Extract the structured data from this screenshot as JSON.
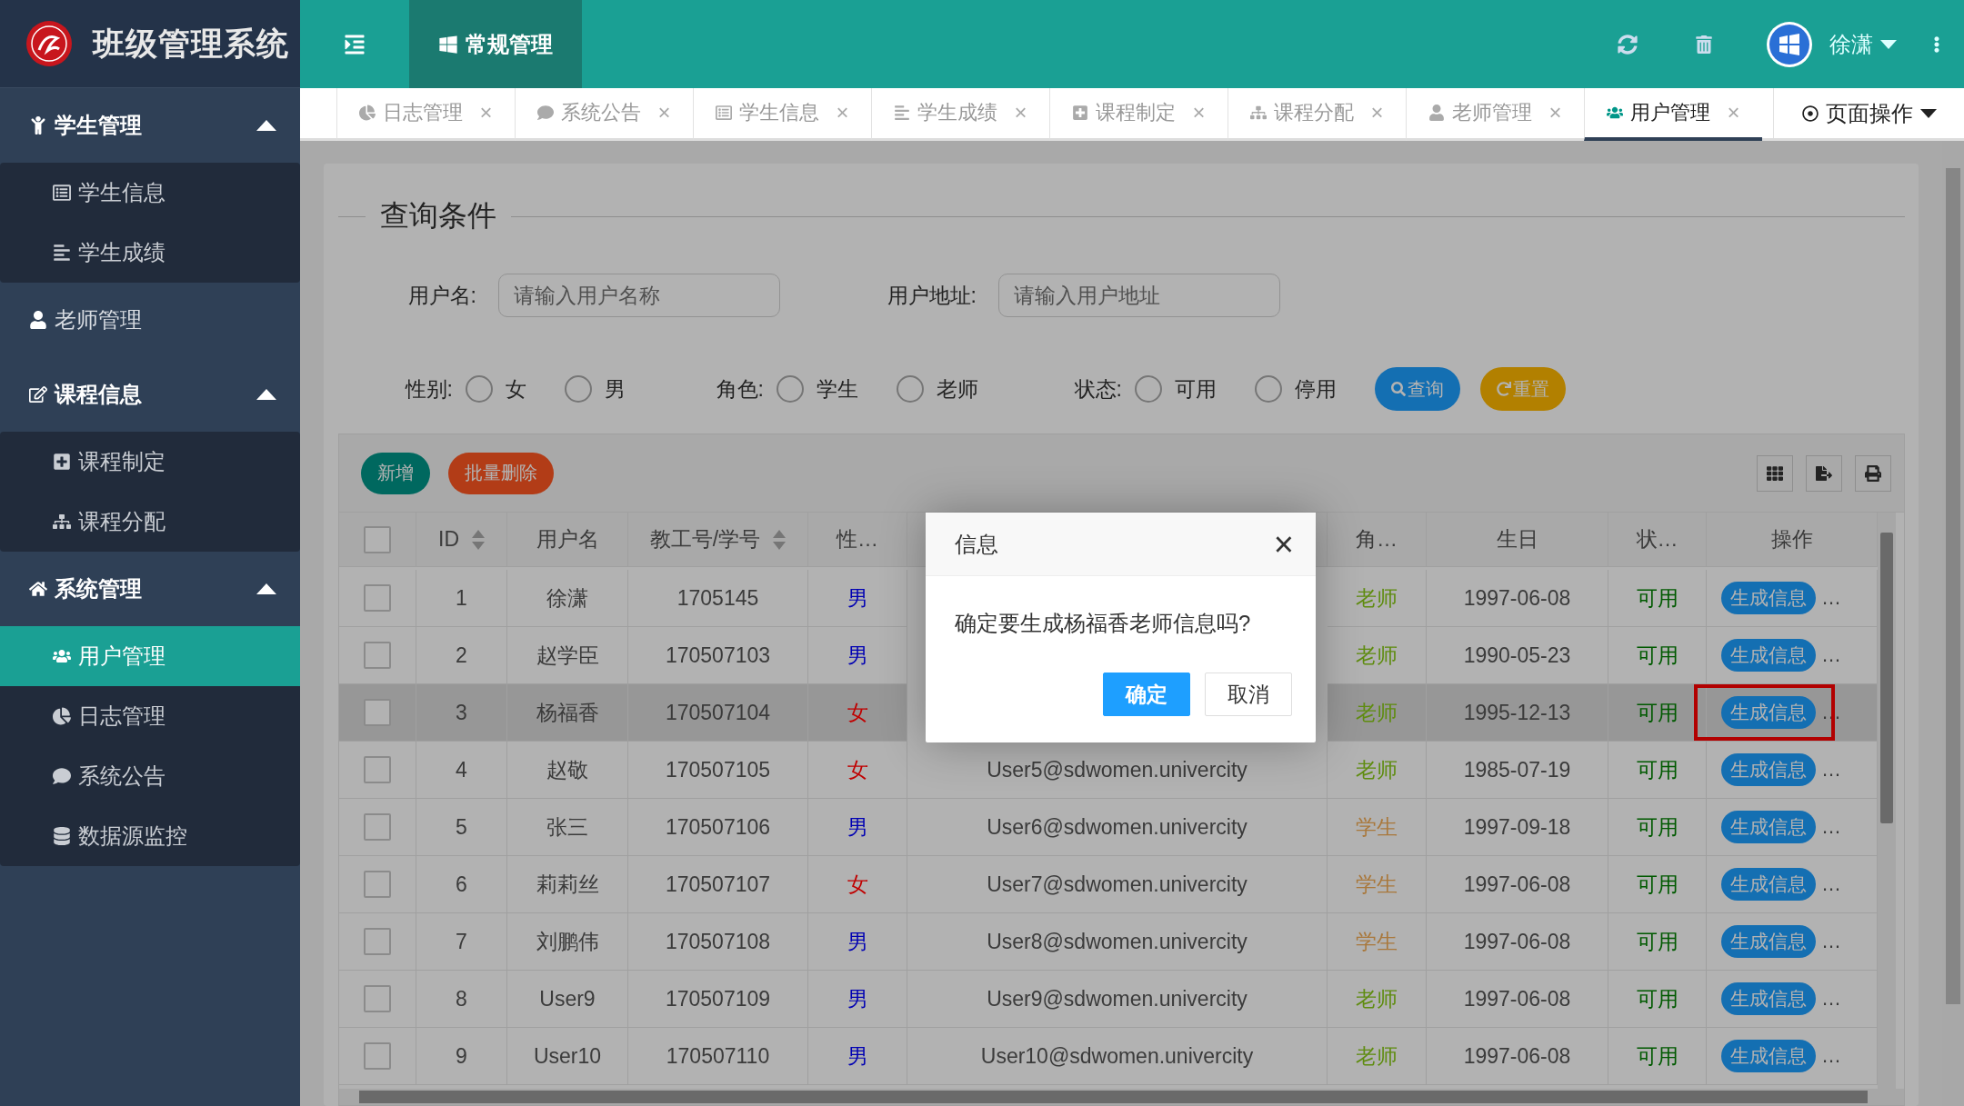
{
  "app": {
    "title": "班级管理系统",
    "header_tab": {
      "label": "常规管理",
      "selected": true
    },
    "user": "徐潇"
  },
  "sidebar": [
    {
      "label": "学生管理",
      "expanded": true,
      "children": [
        {
          "label": "学生信息",
          "selected": false
        },
        {
          "label": "学生成绩",
          "selected": false
        }
      ]
    },
    {
      "label": "老师管理"
    },
    {
      "label": "课程信息",
      "expanded": true,
      "children": [
        {
          "label": "课程制定",
          "selected": false
        },
        {
          "label": "课程分配",
          "selected": false
        }
      ]
    },
    {
      "label": "系统管理",
      "expanded": true,
      "children": [
        {
          "label": "用户管理",
          "selected": true
        },
        {
          "label": "日志管理",
          "selected": false
        },
        {
          "label": "系统公告",
          "selected": false
        },
        {
          "label": "数据源监控",
          "selected": false
        }
      ]
    }
  ],
  "tabs": [
    {
      "label": "日志管理",
      "selected": false,
      "close": "×"
    },
    {
      "label": "系统公告",
      "selected": false,
      "close": "×"
    },
    {
      "label": "学生信息",
      "selected": false,
      "close": "×"
    },
    {
      "label": "学生成绩",
      "selected": false,
      "close": "×"
    },
    {
      "label": "课程制定",
      "selected": false,
      "close": "×"
    },
    {
      "label": "课程分配",
      "selected": false,
      "close": "×"
    },
    {
      "label": "老师管理",
      "selected": false,
      "close": "×"
    },
    {
      "label": "用户管理",
      "selected": true,
      "close": "×"
    }
  ],
  "page_actions": "页面操作",
  "query": {
    "title": "查询条件",
    "fields": [
      {
        "label": "用户名:",
        "placeholder": "请输入用户名称"
      },
      {
        "label": "用户地址:",
        "placeholder": "请输入用户地址"
      }
    ],
    "radio_groups": [
      {
        "label": "性别:",
        "options": [
          {
            "label": "女",
            "selected": false
          },
          {
            "label": "男",
            "selected": false
          }
        ]
      },
      {
        "label": "角色:",
        "options": [
          {
            "label": "学生",
            "selected": false
          },
          {
            "label": "老师",
            "selected": false
          }
        ]
      },
      {
        "label": "状态:",
        "options": [
          {
            "label": "可用",
            "selected": false
          },
          {
            "label": "停用",
            "selected": false
          }
        ]
      }
    ],
    "buttons": [
      {
        "label": "查询",
        "kind": "search"
      },
      {
        "label": "重置",
        "kind": "reset"
      }
    ]
  },
  "toolbar": {
    "buttons": [
      {
        "label": "新增",
        "kind": "add"
      },
      {
        "label": "批量删除",
        "kind": "delete"
      }
    ]
  },
  "table": {
    "select_all_checked": false,
    "columns": [
      {
        "label": "ID",
        "sortable": true
      },
      {
        "label": "用户名",
        "sortable": false
      },
      {
        "label": "教工号/学号",
        "sortable": true
      },
      {
        "label": "性…",
        "sortable": false
      },
      {
        "label": "角…",
        "sortable": false
      },
      {
        "label": "生日",
        "sortable": false
      },
      {
        "label": "状…",
        "sortable": false
      },
      {
        "label": "操作",
        "sortable": false
      }
    ],
    "rows": [
      {
        "checked": false,
        "selected": false,
        "marked": false,
        "id": "1",
        "name": "徐潇",
        "number": "1705145",
        "gender": {
          "text": "男",
          "color": "#0000b3"
        },
        "role": {
          "text": "老师",
          "color": "#5f8c10"
        },
        "birthday": "1997-06-08",
        "status": "可用",
        "action": "生成信息",
        "more": "…"
      },
      {
        "checked": false,
        "selected": false,
        "marked": false,
        "id": "2",
        "name": "赵学臣",
        "number": "170507103",
        "gender": {
          "text": "男",
          "color": "#0000b3"
        },
        "role": {
          "text": "老师",
          "color": "#5f8c10"
        },
        "birthday": "1990-05-23",
        "status": "可用",
        "action": "生成信息",
        "more": "…"
      },
      {
        "checked": false,
        "selected": true,
        "marked": true,
        "id": "3",
        "name": "杨福香",
        "number": "170507104",
        "gender": {
          "text": "女",
          "color": "#c00000"
        },
        "role": {
          "text": "老师",
          "color": "#5f8c10"
        },
        "birthday": "1995-12-13",
        "status": "可用",
        "action": "生成信息",
        "more": "…"
      },
      {
        "checked": false,
        "selected": false,
        "marked": false,
        "id": "4",
        "name": "赵敬",
        "number": "170507105",
        "gender": {
          "text": "女",
          "color": "#c00000"
        },
        "email": "User5@sdwomen.univercity",
        "role": {
          "text": "老师",
          "color": "#5f8c10"
        },
        "birthday": "1985-07-19",
        "status": "可用",
        "action": "生成信息",
        "more": "…"
      },
      {
        "checked": false,
        "selected": false,
        "marked": false,
        "id": "5",
        "name": "张三",
        "number": "170507106",
        "gender": {
          "text": "男",
          "color": "#0000b3"
        },
        "email": "User6@sdwomen.univercity",
        "role": {
          "text": "学生",
          "color": "#a9783c"
        },
        "birthday": "1997-09-18",
        "status": "可用",
        "action": "生成信息",
        "more": "…"
      },
      {
        "checked": false,
        "selected": false,
        "marked": false,
        "id": "6",
        "name": "莉莉丝",
        "number": "170507107",
        "gender": {
          "text": "女",
          "color": "#c00000"
        },
        "email": "User7@sdwomen.univercity",
        "role": {
          "text": "学生",
          "color": "#a9783c"
        },
        "birthday": "1997-06-08",
        "status": "可用",
        "action": "生成信息",
        "more": "…"
      },
      {
        "checked": false,
        "selected": false,
        "marked": false,
        "id": "7",
        "name": "刘鹏伟",
        "number": "170507108",
        "gender": {
          "text": "男",
          "color": "#0000b3"
        },
        "email": "User8@sdwomen.univercity",
        "role": {
          "text": "学生",
          "color": "#a9783c"
        },
        "birthday": "1997-06-08",
        "status": "可用",
        "action": "生成信息",
        "more": "…"
      },
      {
        "checked": false,
        "selected": false,
        "marked": false,
        "id": "8",
        "name": "User9",
        "number": "170507109",
        "gender": {
          "text": "男",
          "color": "#0000b3"
        },
        "email": "User9@sdwomen.univercity",
        "role": {
          "text": "老师",
          "color": "#5f8c10"
        },
        "birthday": "1997-06-08",
        "status": "可用",
        "action": "生成信息",
        "more": "…"
      },
      {
        "checked": false,
        "selected": false,
        "marked": false,
        "id": "9",
        "name": "User10",
        "number": "170507110",
        "gender": {
          "text": "男",
          "color": "#0000b3"
        },
        "email": "User10@sdwomen.univercity",
        "role": {
          "text": "老师",
          "color": "#5f8c10"
        },
        "birthday": "1997-06-08",
        "status": "可用",
        "action": "生成信息",
        "more": "…"
      }
    ]
  },
  "dialog": {
    "title": "信息",
    "close": "×",
    "message": "确定要生成杨福香老师信息吗?",
    "buttons": [
      {
        "label": "确定",
        "kind": "primary"
      },
      {
        "label": "取消",
        "kind": "secondary"
      }
    ]
  }
}
